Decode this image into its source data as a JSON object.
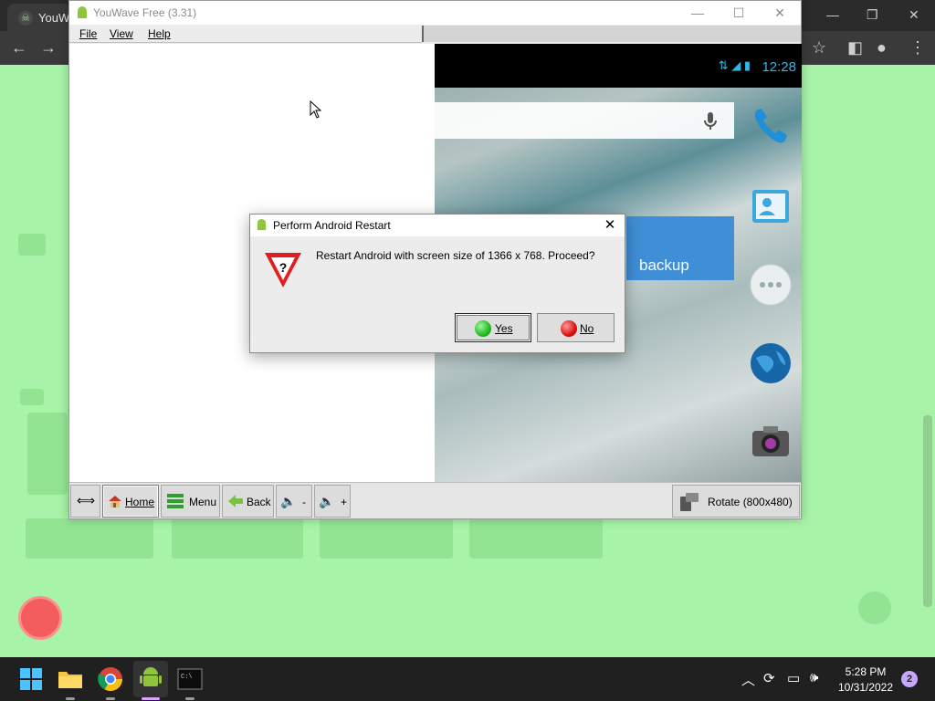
{
  "browser": {
    "tab_title": "YouW",
    "toolbar": {
      "back": "back-icon",
      "forward": "forward-icon"
    }
  },
  "window": {
    "title": "YouWave Free (3.31)",
    "controls": {
      "minimize": "—",
      "maximize": "☐",
      "close": "✕"
    },
    "menu": [
      "File",
      "View",
      "Help"
    ]
  },
  "android": {
    "clock": "12:28",
    "card_text": "backup"
  },
  "toolbar": {
    "resize": "⟺",
    "home": "Home",
    "menu": "Menu",
    "back": "Back",
    "vol_down": "-",
    "vol_up": "+",
    "rotate": "Rotate (800x480)"
  },
  "dialog": {
    "title": "Perform Android Restart",
    "message": "Restart Android with screen size of 1366 x 768. Proceed?",
    "yes_label": "Yes",
    "no_label": "No",
    "close": "✕"
  },
  "taskbar": {
    "time": "5:28 PM",
    "date": "10/31/2022",
    "notification_count": "2"
  },
  "colors": {
    "android_accent": "#35b5e5",
    "card_blue": "#3f8ed6",
    "yes_green": "#22bb22",
    "no_red": "#dd1111",
    "background_green": "#a6f2a7"
  }
}
